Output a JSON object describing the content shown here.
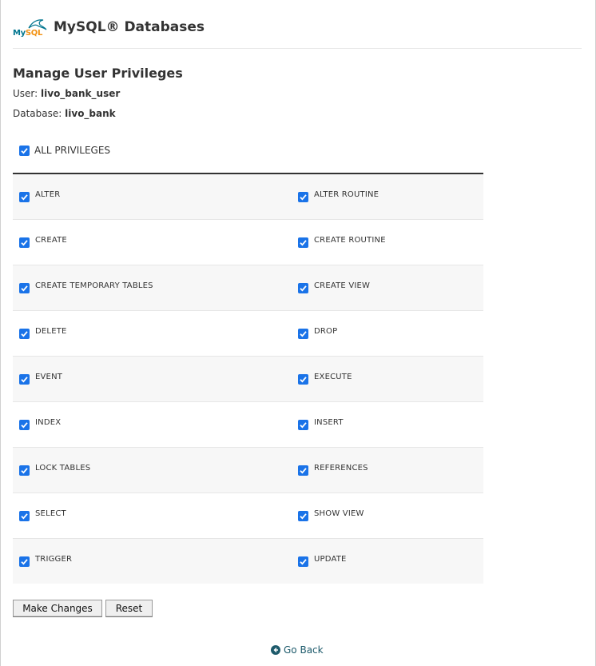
{
  "header": {
    "logo_text_my": "My",
    "logo_text_sql": "SQL",
    "app_title": "MySQL® Databases"
  },
  "page": {
    "title": "Manage User Privileges",
    "user_label": "User:",
    "user_value": "livo_bank_user",
    "database_label": "Database:",
    "database_value": "livo_bank"
  },
  "all_privileges": {
    "label": "ALL PRIVILEGES",
    "checked": true
  },
  "privileges": [
    [
      "ALTER",
      "ALTER ROUTINE"
    ],
    [
      "CREATE",
      "CREATE ROUTINE"
    ],
    [
      "CREATE TEMPORARY TABLES",
      "CREATE VIEW"
    ],
    [
      "DELETE",
      "DROP"
    ],
    [
      "EVENT",
      "EXECUTE"
    ],
    [
      "INDEX",
      "INSERT"
    ],
    [
      "LOCK TABLES",
      "REFERENCES"
    ],
    [
      "SELECT",
      "SHOW VIEW"
    ],
    [
      "TRIGGER",
      "UPDATE"
    ]
  ],
  "buttons": {
    "make_changes": "Make Changes",
    "reset": "Reset"
  },
  "go_back": "Go Back",
  "colors": {
    "checkbox": "#1a73e8",
    "link": "#1d5a6b",
    "row_alt": "#f7f7f7"
  }
}
